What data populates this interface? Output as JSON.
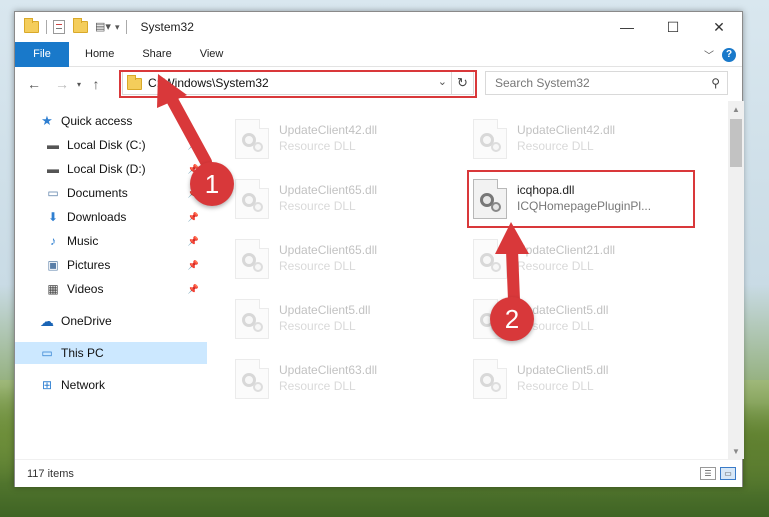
{
  "window": {
    "title": "System32",
    "controls": {
      "minimize": "—",
      "maximize": "☐",
      "close": "✕"
    }
  },
  "ribbon": {
    "tabs": [
      "File",
      "Home",
      "Share",
      "View"
    ]
  },
  "address": {
    "path": "C:\\Windows\\System32",
    "search_placeholder": "Search System32"
  },
  "navpane": {
    "items": [
      {
        "label": "Quick access",
        "icon": "star-icon"
      },
      {
        "label": "Local Disk (C:)",
        "icon": "drive-icon"
      },
      {
        "label": "Local Disk (D:)",
        "icon": "drive-icon"
      },
      {
        "label": "Documents",
        "icon": "documents-icon"
      },
      {
        "label": "Downloads",
        "icon": "download-icon"
      },
      {
        "label": "Music",
        "icon": "music-icon"
      },
      {
        "label": "Pictures",
        "icon": "pictures-icon"
      },
      {
        "label": "Videos",
        "icon": "videos-icon"
      },
      {
        "label": "OneDrive",
        "icon": "cloud-icon"
      },
      {
        "label": "This PC",
        "icon": "computer-icon"
      },
      {
        "label": "Network",
        "icon": "network-icon"
      }
    ]
  },
  "files": {
    "col1": [
      {
        "name": "UpdateClient42.dll",
        "type": "Resource DLL"
      },
      {
        "name": "UpdateClient65.dll",
        "type": "Resource DLL"
      },
      {
        "name": "UpdateClient65.dll",
        "type": "Resource DLL"
      },
      {
        "name": "UpdateClient5.dll",
        "type": "Resource DLL"
      },
      {
        "name": "UpdateClient63.dll",
        "type": "Resource DLL"
      }
    ],
    "col2": [
      {
        "name": "UpdateClient42.dll",
        "type": "Resource DLL"
      },
      {
        "name": "icqhopa.dll",
        "type": "ICQHomepagePluginPl..."
      },
      {
        "name": "UpdateClient21.dll",
        "type": "Resource DLL"
      },
      {
        "name": "UpdateClient5.dll",
        "type": "Resource DLL"
      },
      {
        "name": "UpdateClient5.dll",
        "type": "Resource DLL"
      }
    ]
  },
  "status": {
    "item_count": "117 items"
  },
  "annotations": {
    "step1": "1",
    "step2": "2",
    "color": "#d9383a"
  }
}
